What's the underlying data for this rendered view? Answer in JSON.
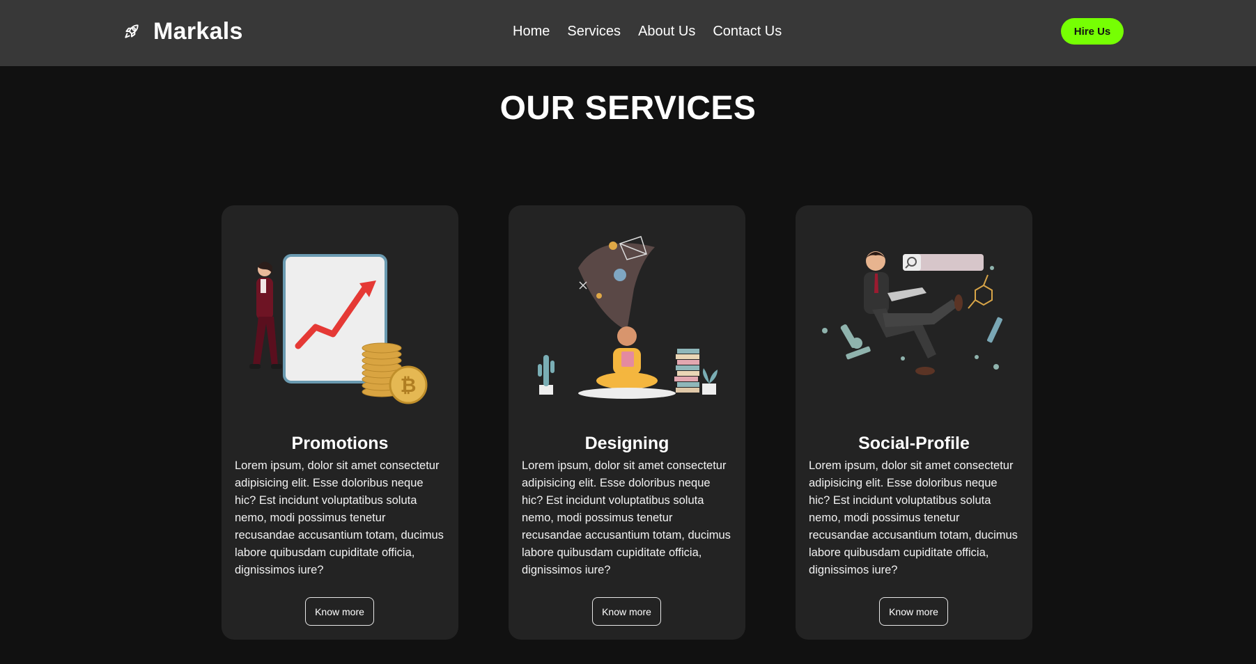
{
  "header": {
    "brand": "Markals",
    "brand_icon": "rocket-icon",
    "nav": [
      "Home",
      "Services",
      "About Us",
      "Contact Us"
    ],
    "cta": "Hire Us"
  },
  "colors": {
    "background": "#111111",
    "navbar": "#383838",
    "card": "#232323",
    "accent": "#76ff03"
  },
  "main": {
    "title": "OUR SERVICES",
    "cards": [
      {
        "title": "Promotions",
        "image": "businesswoman-growth-chart-coins-illustration",
        "text": "Lorem ipsum, dolor sit amet consectetur adipisicing elit. Esse doloribus neque hic? Est incidunt voluptatibus soluta nemo, modi possimus tenetur recusandae accusantium totam, ducimus labore quibusdam cupiditate officia, dignissimos iure?",
        "button": "Know more"
      },
      {
        "title": "Designing",
        "image": "meditating-designer-ideas-illustration",
        "text": "Lorem ipsum, dolor sit amet consectetur adipisicing elit. Esse doloribus neque hic? Est incidunt voluptatibus soluta nemo, modi possimus tenetur recusandae accusantium totam, ducimus labore quibusdam cupiditate officia, dignissimos iure?",
        "button": "Know more"
      },
      {
        "title": "Social-Profile",
        "image": "businessman-laptop-search-illustration",
        "text": "Lorem ipsum, dolor sit amet consectetur adipisicing elit. Esse doloribus neque hic? Est incidunt voluptatibus soluta nemo, modi possimus tenetur recusandae accusantium totam, ducimus labore quibusdam cupiditate officia, dignissimos iure?",
        "button": "Know more"
      }
    ]
  }
}
